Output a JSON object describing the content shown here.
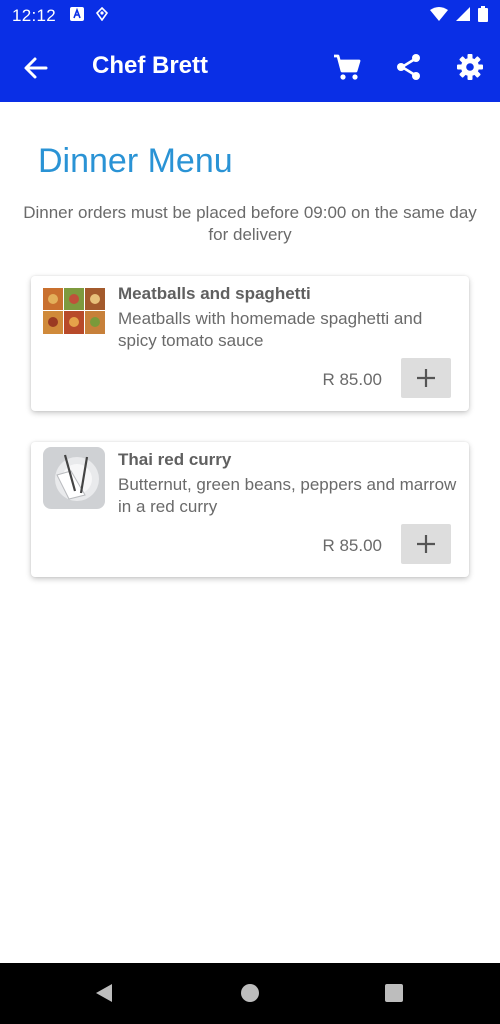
{
  "status_bar": {
    "time": "12:12",
    "icons": [
      "a-badge-icon",
      "location-icon",
      "wifi-icon",
      "signal-icon",
      "battery-icon"
    ]
  },
  "app_bar": {
    "title": "Chef Brett",
    "icons": [
      "back-arrow-icon",
      "cart-icon",
      "share-icon",
      "settings-icon"
    ]
  },
  "page": {
    "heading": "Dinner Menu",
    "notice": "Dinner orders must be placed before 09:00 on the same day for delivery"
  },
  "menu": {
    "items": [
      {
        "title": "Meatballs and spaghetti",
        "description": "Meatballs with homemade spaghetti and spicy tomato sauce",
        "price": "R 85.00",
        "thumbnail": "food-collage-image"
      },
      {
        "title": "Thai red curry",
        "description": "Butternut, green beans, peppers and marrow in a red curry",
        "price": "R 85.00",
        "thumbnail": "cutlery-plate-image"
      }
    ]
  },
  "nav_bar": {
    "icons": [
      "back-triangle-icon",
      "home-circle-icon",
      "recents-square-icon"
    ]
  },
  "colors": {
    "primary": "#0a2fe6",
    "heading": "#2a93d5",
    "text": "#6a6a6a",
    "add_button": "#dddddd"
  }
}
